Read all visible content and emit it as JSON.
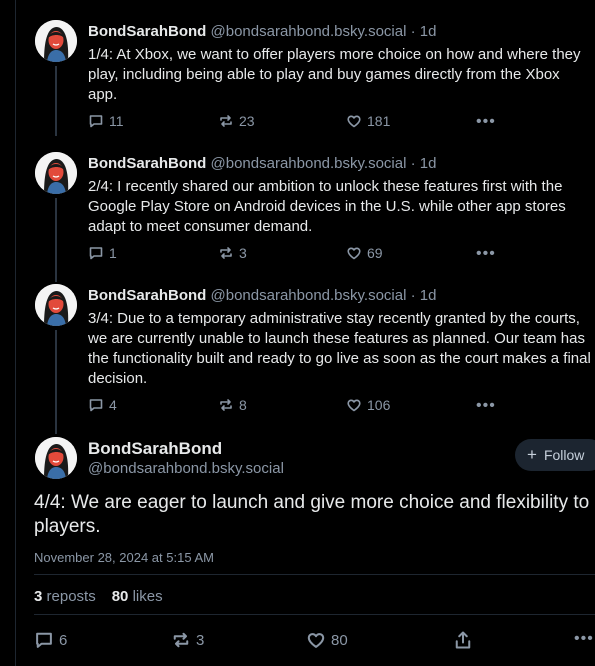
{
  "thread": [
    {
      "name": "BondSarahBond",
      "handle": "@bondsarahbond.bsky.social",
      "dot": "·",
      "age": "1d",
      "text": "1/4: At Xbox, we want to offer players more choice on how and where they play, including being able to play and buy games directly from the Xbox app.",
      "replies": "11",
      "reposts": "23",
      "likes": "181",
      "more": "•••"
    },
    {
      "name": "BondSarahBond",
      "handle": "@bondsarahbond.bsky.social",
      "dot": "·",
      "age": "1d",
      "text": "2/4: I recently shared our ambition to unlock these features first with the Google Play Store on Android devices in the U.S. while other app stores adapt to meet consumer demand.",
      "replies": "1",
      "reposts": "3",
      "likes": "69",
      "more": "•••"
    },
    {
      "name": "BondSarahBond",
      "handle": "@bondsarahbond.bsky.social",
      "dot": "·",
      "age": "1d",
      "text": "3/4: Due to a temporary administrative stay recently granted by the courts, we are currently unable to launch these features as planned. Our team has the functionality built and ready to go live as soon as the court makes a final decision.",
      "replies": "4",
      "reposts": "8",
      "likes": "106",
      "more": "•••"
    }
  ],
  "main_post": {
    "name": "BondSarahBond",
    "handle": "@bondsarahbond.bsky.social",
    "follow_label": "Follow",
    "follow_plus": "+",
    "text": "4/4: We are eager to launch and give more choice and flexibility to players.",
    "timestamp": "November 28, 2024 at 5:15 AM",
    "reposts_count": "3",
    "reposts_label": "reposts",
    "likes_count": "80",
    "likes_label": "likes",
    "replies": "6",
    "reposts": "3",
    "likes": "80",
    "more": "•••"
  },
  "icons": {
    "reply": "speech-bubble-icon",
    "repost": "repost-arrows-icon",
    "like": "heart-icon",
    "share": "share-icon",
    "more": "ellipsis-icon"
  },
  "colors": {
    "background": "#000000",
    "text": "#e7e9ea",
    "muted": "#8b97a6",
    "follow_bg": "#1c2530"
  }
}
